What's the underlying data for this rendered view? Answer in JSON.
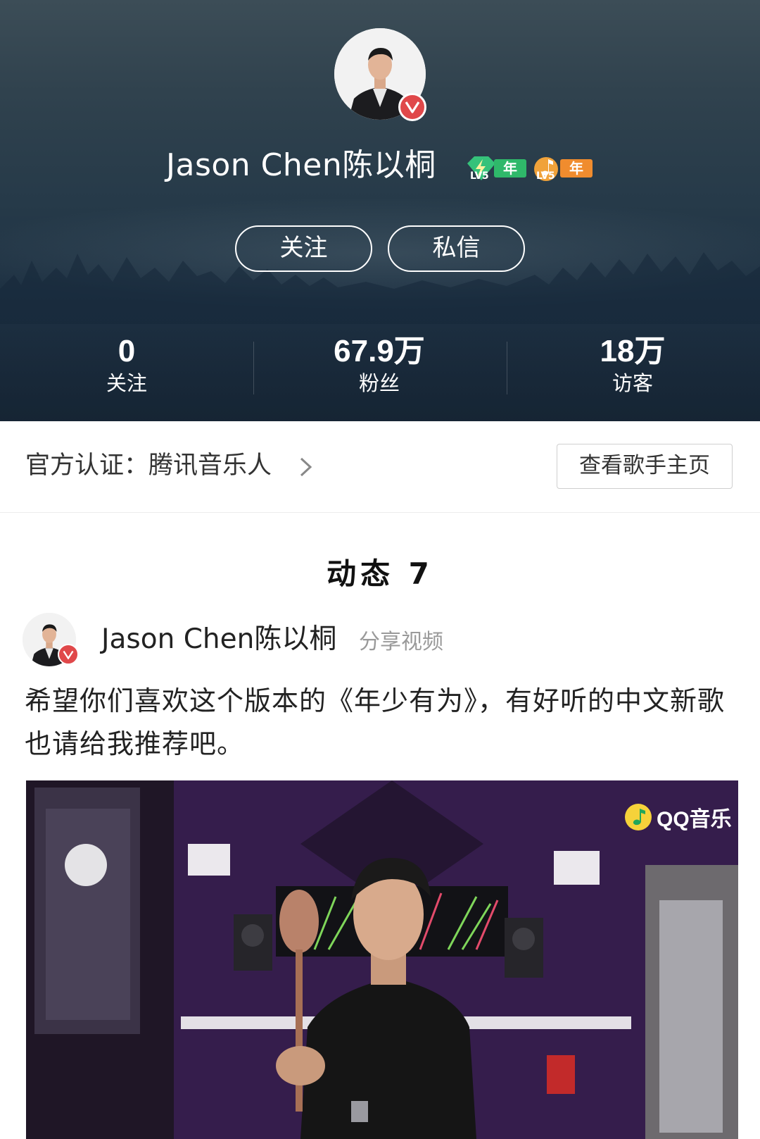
{
  "profile": {
    "name": "Jason Chen陈以桐",
    "badges": [
      {
        "level": "LV5",
        "suffix": "年",
        "color": "#2fb86a"
      },
      {
        "level": "LV5",
        "suffix": "年",
        "color": "#f08c2e"
      }
    ],
    "verified_icon": "verified-v-icon"
  },
  "actions": {
    "follow_label": "关注",
    "message_label": "私信"
  },
  "stats": [
    {
      "value": "0",
      "label": "关注"
    },
    {
      "value": "67.9万",
      "label": "粉丝"
    },
    {
      "value": "18万",
      "label": "访客"
    }
  ],
  "certification": {
    "text": "官方认证：腾讯音乐人",
    "singer_page_label": "查看歌手主页"
  },
  "feed": {
    "title": "动态 7",
    "post": {
      "author": "Jason Chen陈以桐",
      "type": "分享视频",
      "text": "希望你们喜欢这个版本的《年少有为》，有好听的中文新歌也请给我推荐吧。",
      "video_watermark": "QQ音乐"
    }
  },
  "colors": {
    "verified": "#e0484a",
    "header_bg": "#263a49"
  }
}
